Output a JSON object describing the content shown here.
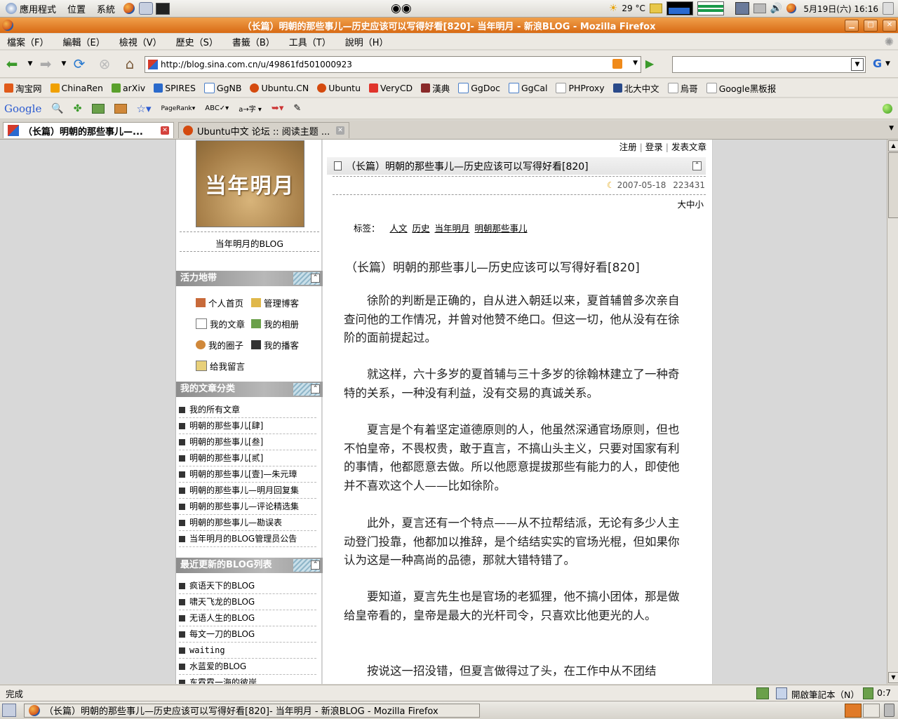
{
  "top_panel": {
    "apps_menu": "應用程式",
    "places_menu": "位置",
    "system_menu": "系統",
    "weather": "29 °C",
    "clock": "5月19日(六) 16:16"
  },
  "window": {
    "title": "（长篇）明朝的那些事儿—历史应该可以写得好看[820]- 当年明月 - 新浪BLOG - Mozilla Firefox"
  },
  "menubar": {
    "items": [
      "檔案（F）",
      "編輯（E）",
      "檢視（V）",
      "歷史（S）",
      "書籤（B）",
      "工具（T）",
      "說明（H）"
    ]
  },
  "navbar": {
    "url": "http://blog.sina.com.cn/u/49861fd501000923",
    "search_value": ""
  },
  "bookmarks": [
    {
      "label": "淘宝网",
      "color": "#e05a1a"
    },
    {
      "label": "ChinaRen",
      "color": "#f0a000"
    },
    {
      "label": "arXiv",
      "color": "#5aa02c"
    },
    {
      "label": "SPIRES",
      "color": "#2a6acb"
    },
    {
      "label": "GgNB",
      "color": "#4a7fc8"
    },
    {
      "label": "Ubuntu.CN",
      "color": "#d44a0e"
    },
    {
      "label": "Ubuntu",
      "color": "#d44a0e"
    },
    {
      "label": "VeryCD",
      "color": "#e0342b"
    },
    {
      "label": "漢典",
      "color": "#8a2a2a"
    },
    {
      "label": "GgDoc",
      "color": "#4a7fc8"
    },
    {
      "label": "GgCal",
      "color": "#4a7fc8"
    },
    {
      "label": "PHProxy",
      "color": "#ffffff"
    },
    {
      "label": "北大中文",
      "color": "#2a4a8a"
    },
    {
      "label": "烏哥",
      "color": "#ffffff"
    },
    {
      "label": "Google黑板报",
      "color": "#ffffff"
    }
  ],
  "google_toolbar": {
    "logo": "Google",
    "pagerank": "PageRank"
  },
  "tabs": [
    {
      "label": "（长篇）明朝的那些事儿—...",
      "active": true
    },
    {
      "label": "Ubuntu中文 论坛 :: 阅读主题 ...",
      "active": false
    }
  ],
  "sidebar": {
    "avatar_text": "当年明月",
    "blog_name": "当年明月的BLOG",
    "panel1_title": "活力地带",
    "links": [
      "个人首页",
      "管理博客",
      "我的文章",
      "我的相册",
      "我的圈子",
      "我的播客",
      "给我留言"
    ],
    "panel2_title": "我的文章分类",
    "categories": [
      "我的所有文章",
      "明朝的那些事儿[肆]",
      "明朝的那些事儿[叁]",
      "明朝的那些事儿[贰]",
      "明朝的那些事儿[壹]—朱元璋",
      "明朝的那些事儿—明月回复集",
      "明朝的那些事儿—评论精选集",
      "明朝的那些事儿—勘误表",
      "当年明月的BLOG管理员公告"
    ],
    "panel3_title": "最近更新的BLOG列表",
    "recent": [
      "疯语天下的BLOG",
      "啸天飞龙的BLOG",
      "无语人生的BLOG",
      "每文一刀的BLOG",
      "waiting",
      "水蓝爱的BLOG",
      "东霓霓一海的彼岸"
    ]
  },
  "article": {
    "toplinks": [
      "注册",
      "登录",
      "发表文章"
    ],
    "header_title": "（长篇）明朝的那些事儿—历史应该可以写得好看[820]",
    "date": "2007-05-18",
    "views": "223431",
    "font_size_links": "大中小",
    "tags_label": "标签：",
    "tags": [
      "人文",
      "历史",
      "当年明月",
      "明朝那些事儿"
    ],
    "body_title": "（长篇）明朝的那些事儿—历史应该可以写得好看[820]",
    "paragraphs": [
      "徐阶的判断是正确的，自从进入朝廷以来，夏首辅曾多次亲自查问他的工作情况，并曾对他赞不绝口。但这一切，他从没有在徐阶的面前提起过。",
      "就这样，六十多岁的夏首辅与三十多岁的徐翰林建立了一种奇特的关系，一种没有利益，没有交易的真诚关系。",
      "夏言是个有着坚定道德原则的人，他虽然深通官场原则，但也不怕皇帝，不畏权贵，敢于直言，不搞山头主义，只要对国家有利的事情，他都愿意去做。所以他愿意提拔那些有能力的人，即使他并不喜欢这个人——比如徐阶。",
      "此外，夏言还有一个特点——从不拉帮结派，无论有多少人主动登门投靠，他都加以推辞，是个结结实实的官场光棍，但如果你认为这是一种高尚的品德，那就大错特错了。",
      "要知道，夏言先生也是官场的老狐狸，他不搞小团体，那是做给皇帝看的，皇帝是最大的光杆司令，只喜欢比他更光的人。",
      "按说这一招没错，但夏言做得过了头，在工作中从不团结"
    ]
  },
  "statusbar": {
    "status": "完成",
    "notebook": "開啟筆記本（N）",
    "timer": "0:7"
  },
  "taskbar": {
    "window_button": "（长篇）明朝的那些事儿—历史应该可以写得好看[820]- 当年明月 - 新浪BLOG - Mozilla Firefox"
  },
  "colors": {
    "titlebar": "#e07a28",
    "panel_header": "#9a9a9a",
    "accent_link": "#000000"
  }
}
